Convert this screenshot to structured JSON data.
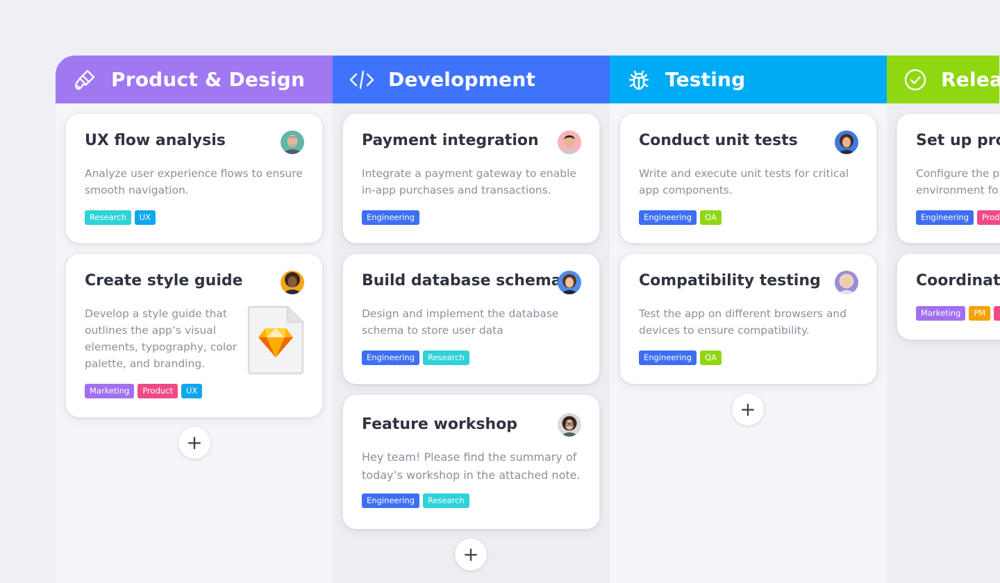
{
  "colors": {
    "product_design": "#a177f2",
    "development": "#3f73fb",
    "testing": "#00abf6",
    "release": "#8fd711",
    "tag_research": "#2ed2d8",
    "tag_ux": "#0ea6ef",
    "tag_engineering": "#3e6ef2",
    "tag_marketing": "#a26ff0",
    "tag_product": "#ef4a86",
    "tag_qa": "#8fd711",
    "tag_pm": "#f6a201"
  },
  "columns": [
    {
      "title": "Product & Design",
      "icon": "paint-brush-icon",
      "cards": [
        {
          "title": "UX flow analysis",
          "description": "Analyze user experience flows to ensure smooth navigation.",
          "avatar": "avatar-man-grey-hair",
          "tags": [
            "Research",
            "UX"
          ]
        },
        {
          "title": "Create style guide",
          "description": "Develop a style guide that outlines the app’s visual elements, typography, color palette, and branding.",
          "avatar": "avatar-woman-curly-hair",
          "attachment": "sketch-file-icon",
          "tags": [
            "Marketing",
            "Product",
            "UX"
          ]
        }
      ],
      "add_label": "+"
    },
    {
      "title": "Development",
      "icon": "code-icon",
      "cards": [
        {
          "title": "Payment integration",
          "description": "Integrate a payment gateway to enable in-app purchases and transactions.",
          "avatar": "avatar-man-pink-bg",
          "tags": [
            "Engineering"
          ]
        },
        {
          "title": "Build database schema",
          "description": "Design and implement the database schema to store user data",
          "avatar": "avatar-woman-blue-bg",
          "tags": [
            "Engineering",
            "Research"
          ]
        },
        {
          "title": "Feature workshop",
          "description": "Hey team! Please find the summary of today’s workshop in the attached note.",
          "avatar": "avatar-woman-glasses",
          "tags": [
            "Engineering",
            "Research"
          ]
        }
      ],
      "add_label": "+"
    },
    {
      "title": "Testing",
      "icon": "bug-icon",
      "cards": [
        {
          "title": "Conduct unit tests",
          "description": "Write and execute unit tests for critical app components.",
          "avatar": "avatar-woman-dark-hair",
          "tags": [
            "Engineering",
            "QA"
          ]
        },
        {
          "title": "Compatibility testing",
          "description": "Test the app on different browsers and devices to ensure compatibility.",
          "avatar": "avatar-woman-blonde",
          "tags": [
            "Engineering",
            "QA"
          ]
        }
      ],
      "add_label": "+"
    },
    {
      "title": "Releas",
      "icon": "check-circle-icon",
      "cards": [
        {
          "title": "Set up proc",
          "description": "Configure the p environment fo",
          "tags": [
            "Engineering",
            "Prod"
          ]
        },
        {
          "title": "Coordinate",
          "tags": [
            "Marketing",
            "PM",
            ""
          ]
        }
      ]
    }
  ]
}
